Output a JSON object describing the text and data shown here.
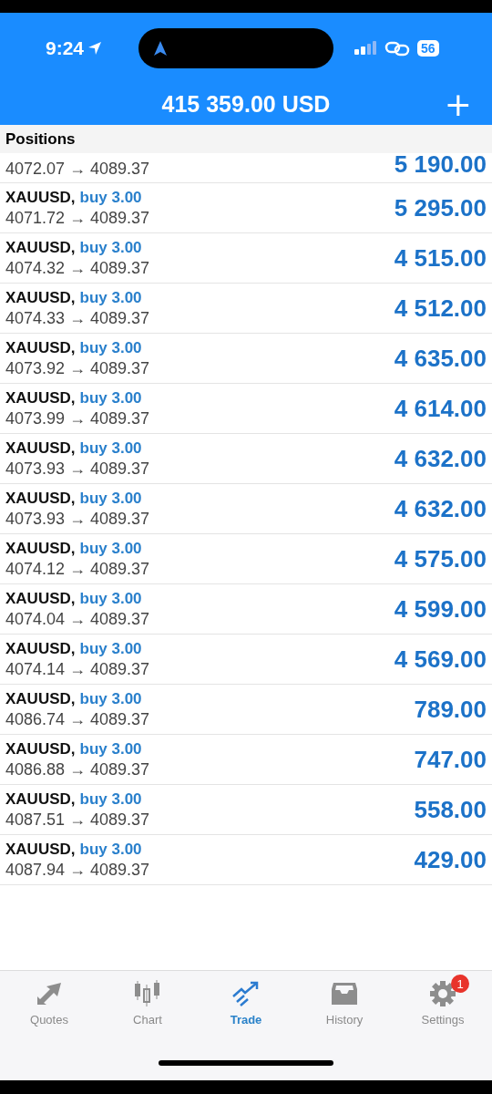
{
  "status_bar": {
    "time": "9:24",
    "battery": "56"
  },
  "header": {
    "title": "415 359.00 USD",
    "add_button": "+"
  },
  "section_title": "Positions",
  "positions": [
    {
      "prices": "4072.07 → 4089.37",
      "profit": "5 190.00"
    },
    {
      "symbol": "XAUUSD,",
      "side": "buy 3.00",
      "prices": "4071.72 → 4089.37",
      "profit": "5 295.00"
    },
    {
      "symbol": "XAUUSD,",
      "side": "buy 3.00",
      "prices": "4074.32 → 4089.37",
      "profit": "4 515.00"
    },
    {
      "symbol": "XAUUSD,",
      "side": "buy 3.00",
      "prices": "4074.33 → 4089.37",
      "profit": "4 512.00"
    },
    {
      "symbol": "XAUUSD,",
      "side": "buy 3.00",
      "prices": "4073.92 → 4089.37",
      "profit": "4 635.00"
    },
    {
      "symbol": "XAUUSD,",
      "side": "buy 3.00",
      "prices": "4073.99 → 4089.37",
      "profit": "4 614.00"
    },
    {
      "symbol": "XAUUSD,",
      "side": "buy 3.00",
      "prices": "4073.93 → 4089.37",
      "profit": "4 632.00"
    },
    {
      "symbol": "XAUUSD,",
      "side": "buy 3.00",
      "prices": "4073.93 → 4089.37",
      "profit": "4 632.00"
    },
    {
      "symbol": "XAUUSD,",
      "side": "buy 3.00",
      "prices": "4074.12 → 4089.37",
      "profit": "4 575.00"
    },
    {
      "symbol": "XAUUSD,",
      "side": "buy 3.00",
      "prices": "4074.04 → 4089.37",
      "profit": "4 599.00"
    },
    {
      "symbol": "XAUUSD,",
      "side": "buy 3.00",
      "prices": "4074.14 → 4089.37",
      "profit": "4 569.00"
    },
    {
      "symbol": "XAUUSD,",
      "side": "buy 3.00",
      "prices": "4086.74 → 4089.37",
      "profit": "789.00"
    },
    {
      "symbol": "XAUUSD,",
      "side": "buy 3.00",
      "prices": "4086.88 → 4089.37",
      "profit": "747.00"
    },
    {
      "symbol": "XAUUSD,",
      "side": "buy 3.00",
      "prices": "4087.51 → 4089.37",
      "profit": "558.00"
    },
    {
      "symbol": "XAUUSD,",
      "side": "buy 3.00",
      "prices": "4087.94 → 4089.37",
      "profit": "429.00"
    }
  ],
  "tabs": [
    {
      "label": "Quotes",
      "kind": "quotes",
      "selected": false
    },
    {
      "label": "Chart",
      "kind": "chart",
      "selected": false
    },
    {
      "label": "Trade",
      "kind": "trade",
      "selected": true
    },
    {
      "label": "History",
      "kind": "history",
      "selected": false
    },
    {
      "label": "Settings",
      "kind": "settings",
      "selected": false,
      "badge": "1"
    }
  ]
}
